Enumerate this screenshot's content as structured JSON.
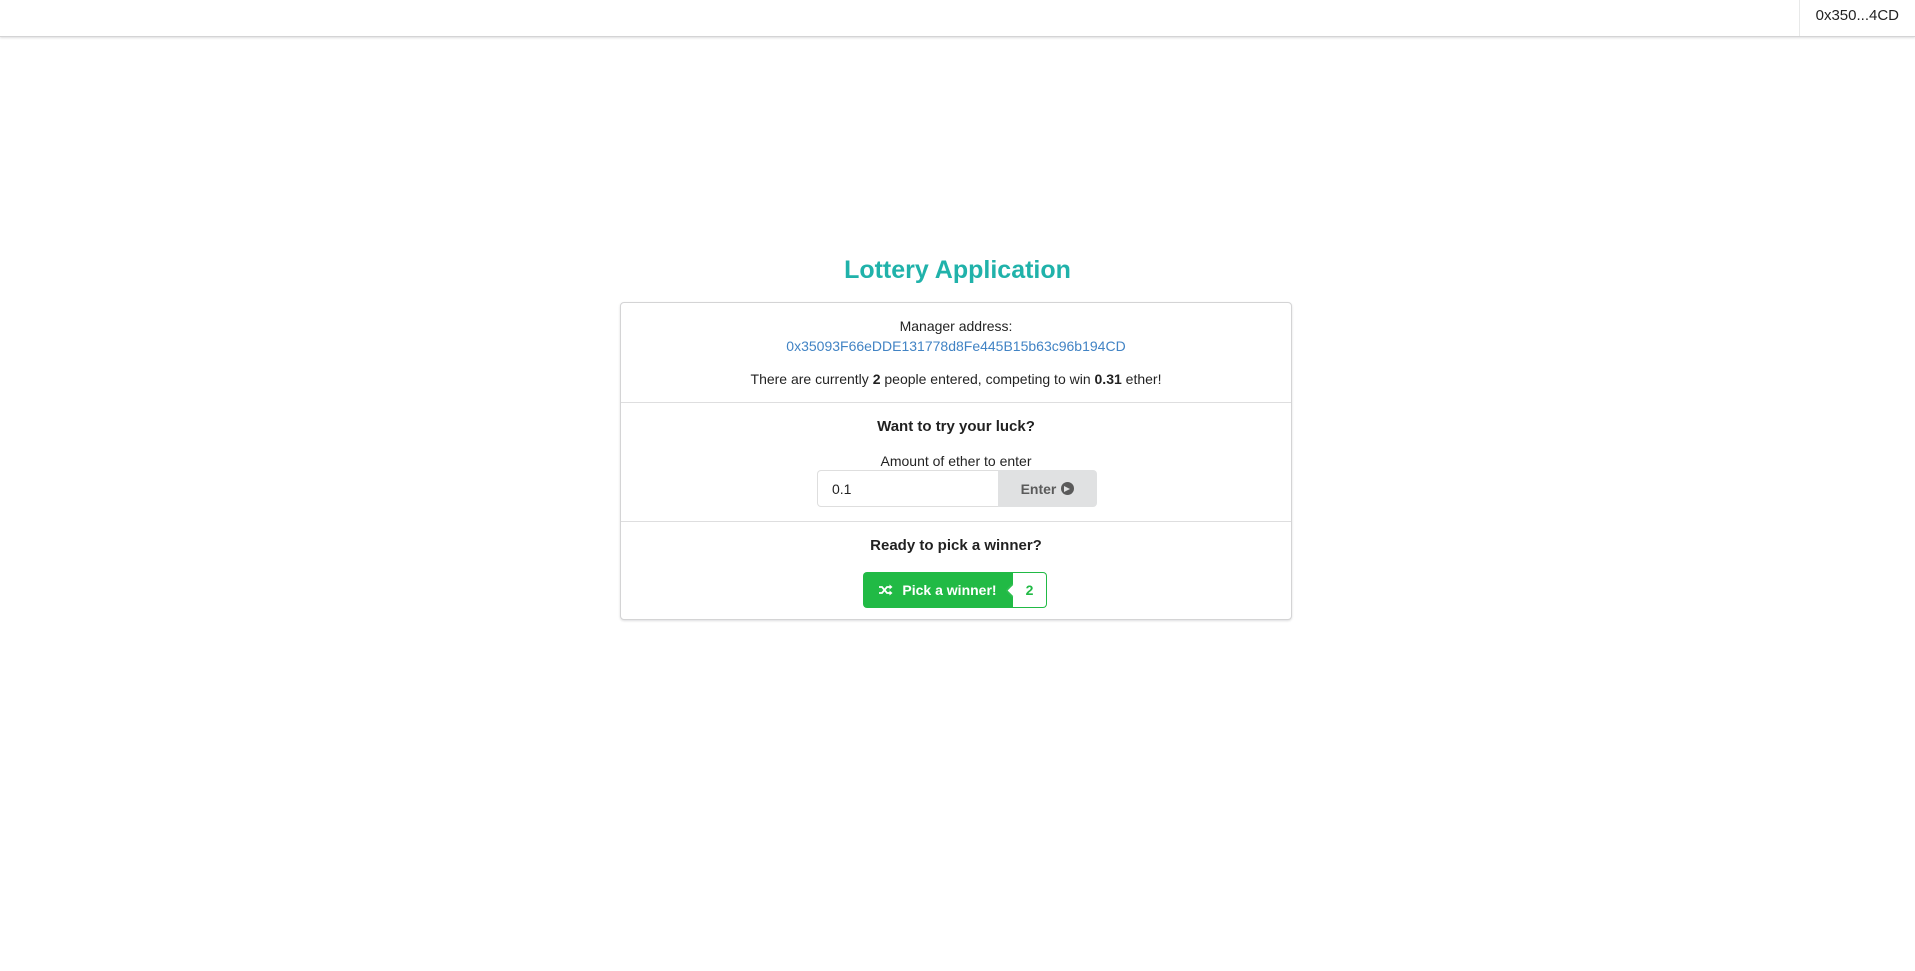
{
  "topbar": {
    "account": "0x350...4CD"
  },
  "app": {
    "title": "Lottery Application"
  },
  "manager": {
    "label": "Manager address:",
    "address": "0x35093F66eDDE131778d8Fe445B15b63c96b194CD"
  },
  "status": {
    "prefix": "There are currently",
    "players": "2",
    "middle": "people entered, competing to win",
    "balance": "0.31",
    "suffix": "ether!"
  },
  "enter_section": {
    "heading": "Want to try your luck?",
    "field_label": "Amount of ether to enter",
    "amount_value": "0.1",
    "button_label": "Enter"
  },
  "pick_section": {
    "heading": "Ready to pick a winner?",
    "button_label": "Pick a winner!",
    "count": "2"
  },
  "colors": {
    "title": "#20b2aa",
    "link": "#4183c4",
    "green": "#21ba45",
    "enter_button_bg": "#e0e1e2"
  }
}
